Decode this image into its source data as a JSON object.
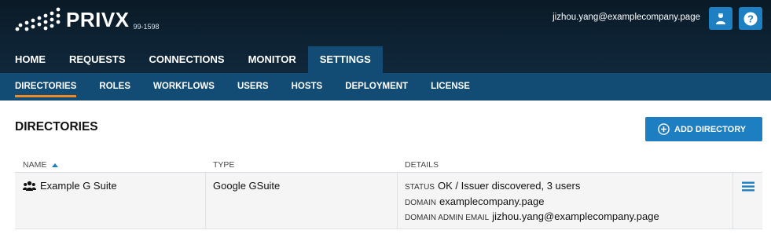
{
  "brand": {
    "name": "PRIVX",
    "version": "99-1598"
  },
  "header": {
    "user_email": "jizhou.yang@examplecompany.page"
  },
  "main_nav": [
    {
      "label": "HOME",
      "active": false
    },
    {
      "label": "REQUESTS",
      "active": false
    },
    {
      "label": "CONNECTIONS",
      "active": false
    },
    {
      "label": "MONITOR",
      "active": false
    },
    {
      "label": "SETTINGS",
      "active": true
    }
  ],
  "sub_nav": [
    {
      "label": "DIRECTORIES",
      "active": true
    },
    {
      "label": "ROLES",
      "active": false
    },
    {
      "label": "WORKFLOWS",
      "active": false
    },
    {
      "label": "USERS",
      "active": false
    },
    {
      "label": "HOSTS",
      "active": false
    },
    {
      "label": "DEPLOYMENT",
      "active": false
    },
    {
      "label": "LICENSE",
      "active": false
    }
  ],
  "page": {
    "title": "DIRECTORIES",
    "add_button": "ADD DIRECTORY"
  },
  "table": {
    "columns": {
      "name": "NAME",
      "type": "TYPE",
      "details": "DETAILS"
    },
    "sort": {
      "column": "name",
      "direction": "asc"
    },
    "rows": [
      {
        "name": "Example G Suite",
        "type": "Google GSuite",
        "status_label": "STATUS",
        "status_value": "OK / Issuer discovered, 3 users",
        "domain_label": "DOMAIN",
        "domain_value": "examplecompany.page",
        "admin_label": "DOMAIN ADMIN EMAIL",
        "admin_value": "jizhou.yang@examplecompany.page"
      }
    ]
  },
  "colors": {
    "header_dark": "#0d2233",
    "nav_active": "#124c75",
    "accent_blue": "#1d7ec1",
    "active_underline": "#f08a24"
  },
  "icons": {
    "logo": "privx-dots-logo",
    "user": "user-icon",
    "help": "help-icon",
    "add": "plus-circle-icon",
    "sort": "sort-asc-icon",
    "group": "group-icon",
    "menu": "hamburger-menu-icon"
  }
}
